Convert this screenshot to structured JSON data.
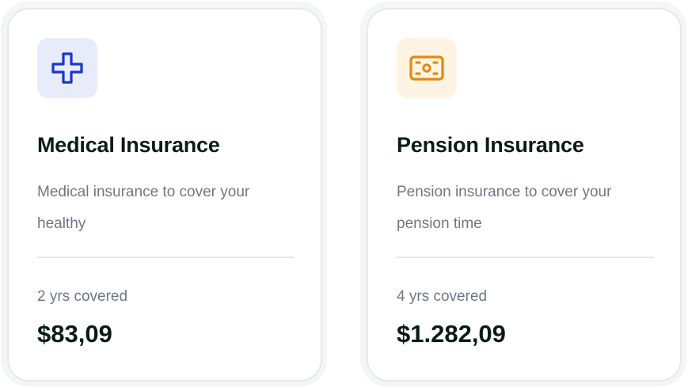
{
  "cards": [
    {
      "icon": "medical-cross-icon",
      "icon_color": "#1a36c8",
      "icon_bg": "#e7ebfa",
      "title": "Medical Insurance",
      "description": "Medical insurance to cover your healthy",
      "coverage": "2 yrs covered",
      "price": "$83,09"
    },
    {
      "icon": "cash-icon",
      "icon_color": "#e08a0f",
      "icon_bg": "#fff4e3",
      "title": "Pension Insurance",
      "description": "Pension insurance to cover your pension time",
      "coverage": "4 yrs covered",
      "price": "$1.282,09"
    }
  ]
}
